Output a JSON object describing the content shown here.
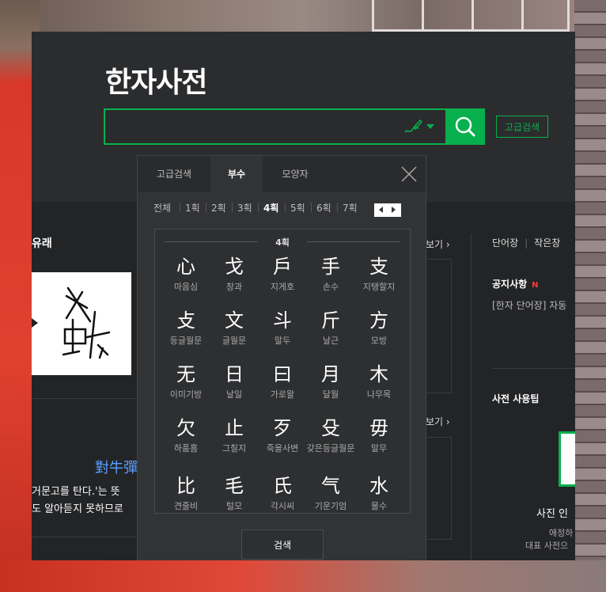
{
  "header": {
    "title": "한자사전",
    "search_placeholder": "",
    "advanced_search": "고급검색"
  },
  "left": {
    "section_title": "유래",
    "idiom": "對牛彈",
    "idiom_text1": "거문고를 탄다.'는 뜻",
    "idiom_text2": "도 알아듣지 못하므로"
  },
  "middle": {
    "more1": "보기 ›",
    "more2": "보기 ›"
  },
  "right": {
    "link1": "단어장",
    "link2": "작은창",
    "notice_title": "공지사항",
    "new_badge": "N",
    "notice_item": "[한자 단어장] 자동",
    "tip_title": "사전 사용팁",
    "tip_caption": "사진 인",
    "tip_sub1": "애정하",
    "tip_sub2": "대표 사전으"
  },
  "popup": {
    "tabs": [
      "고급검색",
      "부수",
      "모양자"
    ],
    "active_tab": 1,
    "strokes": [
      "전체",
      "1획",
      "2획",
      "3획",
      "4획",
      "5획",
      "6획",
      "7획"
    ],
    "active_stroke": 4,
    "grid_header": "4획",
    "radicals": [
      {
        "ch": "心",
        "name": "마음심"
      },
      {
        "ch": "戈",
        "name": "창과"
      },
      {
        "ch": "戶",
        "name": "지게호"
      },
      {
        "ch": "手",
        "name": "손수"
      },
      {
        "ch": "支",
        "name": "지탱할지"
      },
      {
        "ch": "攴",
        "name": "등글월문"
      },
      {
        "ch": "文",
        "name": "글월문"
      },
      {
        "ch": "斗",
        "name": "말두"
      },
      {
        "ch": "斤",
        "name": "날근"
      },
      {
        "ch": "方",
        "name": "모방"
      },
      {
        "ch": "无",
        "name": "이미기방"
      },
      {
        "ch": "日",
        "name": "날일"
      },
      {
        "ch": "曰",
        "name": "가로왈"
      },
      {
        "ch": "月",
        "name": "달월"
      },
      {
        "ch": "木",
        "name": "나무목"
      },
      {
        "ch": "欠",
        "name": "하품흠"
      },
      {
        "ch": "止",
        "name": "그칠지"
      },
      {
        "ch": "歹",
        "name": "죽을사변"
      },
      {
        "ch": "殳",
        "name": "갖은등글월문"
      },
      {
        "ch": "毋",
        "name": "말무"
      },
      {
        "ch": "比",
        "name": "견줄비"
      },
      {
        "ch": "毛",
        "name": "털모"
      },
      {
        "ch": "氏",
        "name": "각시씨"
      },
      {
        "ch": "气",
        "name": "기운기엄"
      },
      {
        "ch": "水",
        "name": "물수"
      }
    ],
    "submit": "검색"
  }
}
